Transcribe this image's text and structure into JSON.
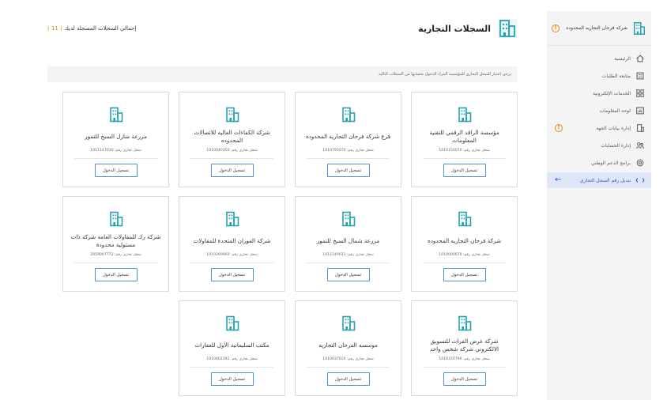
{
  "sidebar": {
    "company_name": "شركة فرحان التجاريه المحدوده",
    "items": [
      {
        "label": "الرئيسية",
        "icon": "home-icon",
        "active": false,
        "warning": false
      },
      {
        "label": "متابعة الطلبات",
        "icon": "requests-icon",
        "active": false,
        "warning": false
      },
      {
        "label": "الخدمات الإلكترونية",
        "icon": "grid-icon",
        "active": false,
        "warning": false
      },
      {
        "label": "لوحة المعلومات",
        "icon": "dashboard-icon",
        "active": false,
        "warning": false
      },
      {
        "label": "إدارة بيانات الجهة",
        "icon": "entity-icon",
        "active": false,
        "warning": true
      },
      {
        "label": "إدارة الحسابات",
        "icon": "users-icon",
        "active": false,
        "warning": false
      },
      {
        "label": "برامج الدعم الوطني",
        "icon": "support-icon",
        "active": false,
        "warning": false
      },
      {
        "label": "تبديل رقم السجل التجاري",
        "icon": "switch-icon",
        "active": true,
        "warning": false
      }
    ]
  },
  "header": {
    "title": "السجلات التجارية",
    "total_label": "إجمالي السجلات المسجلة لديك",
    "total_count": "( 11 )"
  },
  "hint": "يرجى اختيار السجل التجاري للمؤسسة المراد الدخول بحسابها من السجلات التالية",
  "card_reg_label": "سجل تجاري رقم:",
  "card_button_label": "تسجيل الدخول",
  "cards": [
    {
      "name": "مؤسسة الراقد الرقمي للتقنية المعلومات",
      "reg": "1010150070"
    },
    {
      "name": "فرع شركة فرحان التجاريه المحدوده",
      "reg": "1010795070"
    },
    {
      "name": "شركة الكفاءات العاليه للاتصالات المحدوده",
      "reg": "1010040350"
    },
    {
      "name": "مزرعة منازل السبخ للتمور",
      "reg": "1011147030"
    },
    {
      "name": "شركة فرحان التجاريه المحدوده",
      "reg": "1010000670"
    },
    {
      "name": "مزرعة شمال السبخ للتمور",
      "reg": "1011149021"
    },
    {
      "name": "شركة الفوزان المتحدة للمقاولات",
      "reg": "1010269960"
    },
    {
      "name": "شركة رك للمقاولات العامة شركة ذات مسئولية محدودة",
      "reg": "2059007772"
    },
    {
      "name": "شركة غرض الفرات للتسويق الالكتروني شركة شخص واحد",
      "reg": "1010374799"
    },
    {
      "name": "موسسه الفرحان التجاريه",
      "reg": "1010037010"
    },
    {
      "name": "مكتب السليمانية الأول للعقارات",
      "reg": "1010402392"
    }
  ],
  "colors": {
    "accent": "#4a8fd8",
    "building_icon": "#23a3b0",
    "warning": "#e58a00",
    "active_bg": "#dfe6f7"
  }
}
